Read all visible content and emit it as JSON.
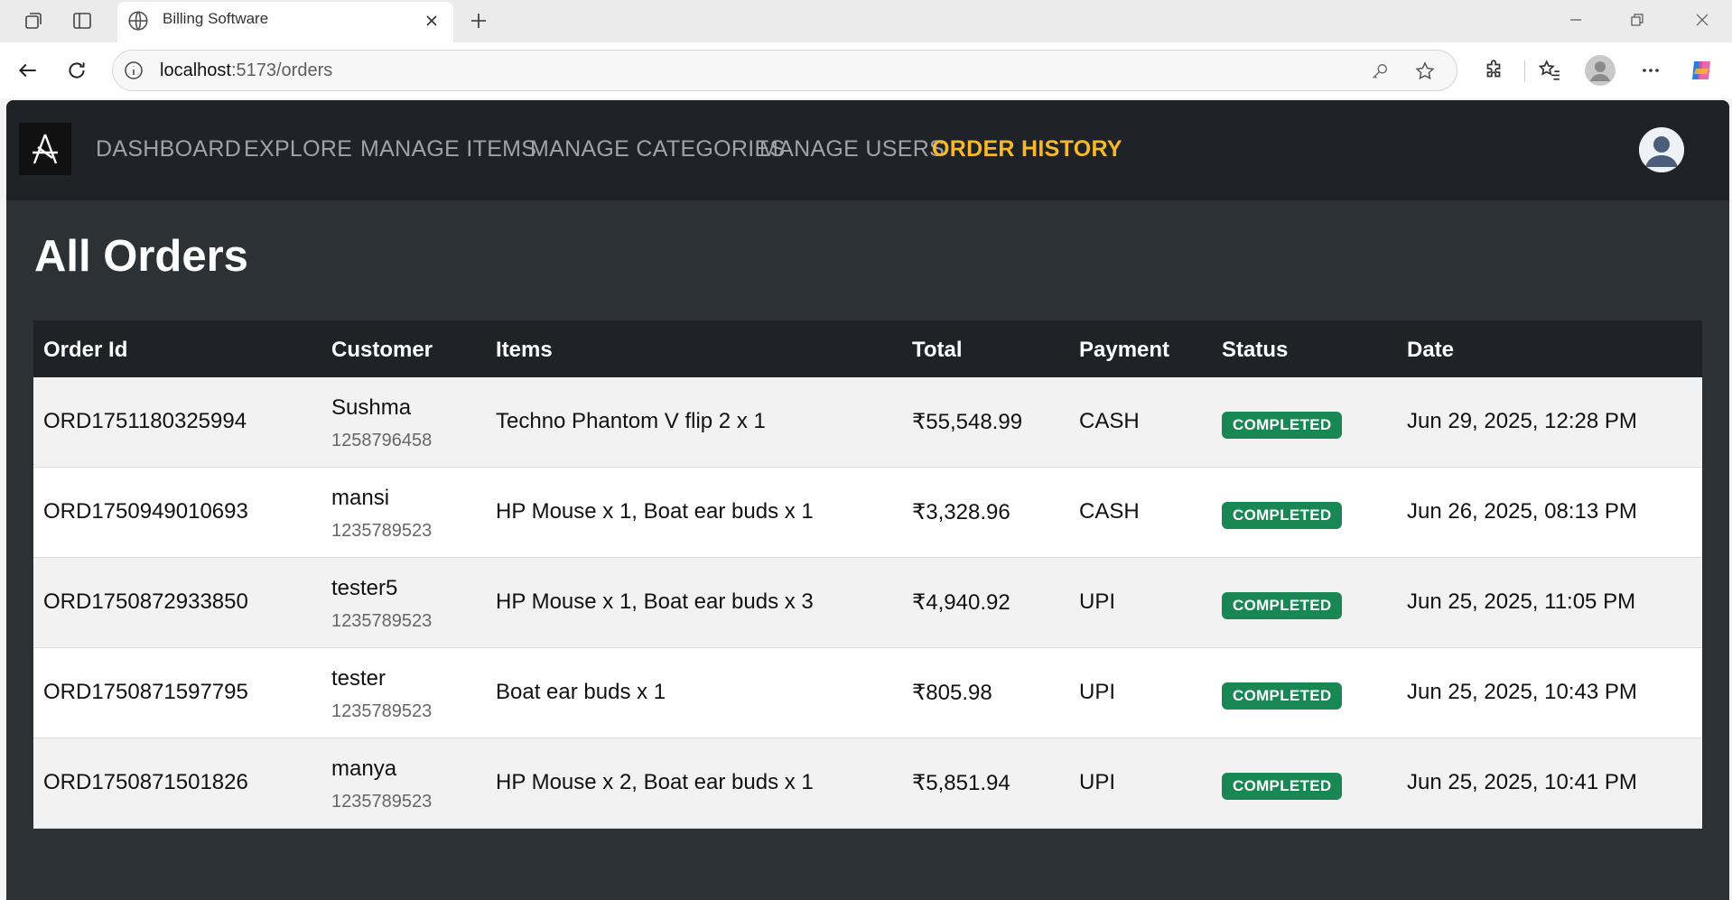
{
  "browser": {
    "tab_title": "Billing Software",
    "url_host": "localhost",
    "url_path": ":5173/orders"
  },
  "nav": {
    "links": [
      "DASHBOARD",
      "EXPLORE",
      "MANAGE ITEMS",
      "MANAGE CATEGORIES",
      "MANAGE USERS",
      "ORDER HISTORY"
    ],
    "active": "ORDER HISTORY",
    "active_color": "#f7b92a"
  },
  "page": {
    "title": "All Orders"
  },
  "table": {
    "headers": [
      "Order Id",
      "Customer",
      "Items",
      "Total",
      "Payment",
      "Status",
      "Date"
    ],
    "rows": [
      {
        "order_id": "ORD1751180325994",
        "customer": "Sushma",
        "phone": "1258796458",
        "items": "Techno Phantom V flip 2 x 1",
        "total": "₹55,548.99",
        "payment": "CASH",
        "status": "COMPLETED",
        "date": "Jun 29, 2025, 12:28 PM"
      },
      {
        "order_id": "ORD1750949010693",
        "customer": "mansi",
        "phone": "1235789523",
        "items": "HP Mouse x 1, Boat ear buds x 1",
        "total": "₹3,328.96",
        "payment": "CASH",
        "status": "COMPLETED",
        "date": "Jun 26, 2025, 08:13 PM"
      },
      {
        "order_id": "ORD1750872933850",
        "customer": "tester5",
        "phone": "1235789523",
        "items": "HP Mouse x 1, Boat ear buds x 3",
        "total": "₹4,940.92",
        "payment": "UPI",
        "status": "COMPLETED",
        "date": "Jun 25, 2025, 11:05 PM"
      },
      {
        "order_id": "ORD1750871597795",
        "customer": "tester",
        "phone": "1235789523",
        "items": "Boat ear buds x 1",
        "total": "₹805.98",
        "payment": "UPI",
        "status": "COMPLETED",
        "date": "Jun 25, 2025, 10:43 PM"
      },
      {
        "order_id": "ORD1750871501826",
        "customer": "manya",
        "phone": "1235789523",
        "items": "HP Mouse x 2, Boat ear buds x 1",
        "total": "₹5,851.94",
        "payment": "UPI",
        "status": "COMPLETED",
        "date": "Jun 25, 2025, 10:41 PM"
      }
    ]
  },
  "colors": {
    "status_completed": "#198754",
    "nav_bg": "#1f2328",
    "page_bg": "#2b3135"
  }
}
